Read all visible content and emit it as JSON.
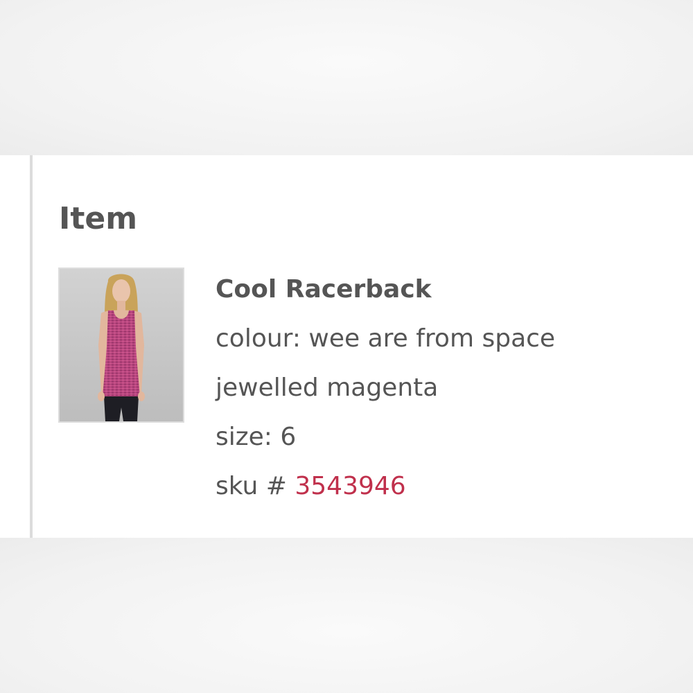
{
  "section": {
    "title": "Item"
  },
  "item": {
    "image_icon": "product-photo-racerback-tank",
    "name": "Cool Racerback",
    "colour_line_1": "colour: wee are from space",
    "colour_line_2": "jewelled magenta",
    "size_text": "size: 6",
    "sku_label": "sku #",
    "sku_number": "3543946"
  },
  "colors": {
    "sku_accent": "#c0304c",
    "text": "#555555",
    "panel_background": "#ffffff"
  }
}
